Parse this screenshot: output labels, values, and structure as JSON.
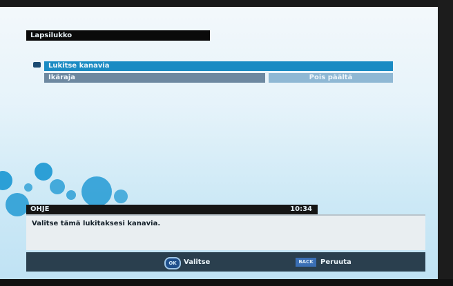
{
  "menu": {
    "title": "Lapsilukko",
    "items": [
      {
        "label": "Lukitse kanavia"
      },
      {
        "label": "Ikäraja",
        "value": "Pois päältä"
      }
    ]
  },
  "help": {
    "header": "OHJE",
    "time": "10:34",
    "text": "Valitse tämä lukitaksesi kanavia."
  },
  "footer": {
    "ok_key": "OK",
    "ok_label": "Valitse",
    "back_key": "BACK",
    "back_label": "Peruuta"
  },
  "colors": {
    "selected_row": "#1a8bc3",
    "normal_row": "#6d88a0",
    "value_box": "#8fb8d4"
  }
}
